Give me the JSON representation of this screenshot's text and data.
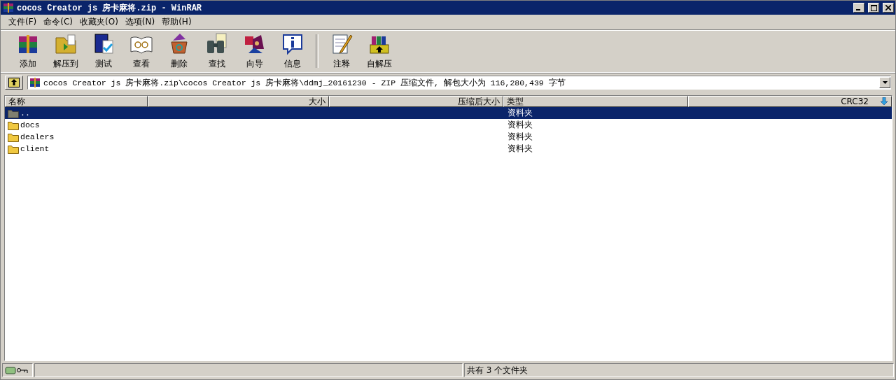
{
  "window": {
    "title": "cocos Creator js 房卡麻将.zip - WinRAR"
  },
  "menu": [
    {
      "label": "文件(F)"
    },
    {
      "label": "命令(C)"
    },
    {
      "label": "收藏夹(O)"
    },
    {
      "label": "选项(N)"
    },
    {
      "label": "帮助(H)"
    }
  ],
  "toolbar": [
    {
      "label": "添加"
    },
    {
      "label": "解压到"
    },
    {
      "label": "测试"
    },
    {
      "label": "查看"
    },
    {
      "label": "删除"
    },
    {
      "label": "查找"
    },
    {
      "label": "向导"
    },
    {
      "label": "信息"
    },
    {
      "label": "注释"
    },
    {
      "label": "自解压"
    }
  ],
  "address": {
    "value": "cocos Creator js 房卡麻将.zip\\cocos Creator js 房卡麻将\\ddmj_20161230 - ZIP 压缩文件, 解包大小为 116,280,439 字节"
  },
  "table": {
    "columns": [
      {
        "label": "名称"
      },
      {
        "label": "大小"
      },
      {
        "label": "压缩后大小"
      },
      {
        "label": "类型"
      },
      {
        "label": "CRC32"
      }
    ],
    "rows": [
      {
        "name": "..",
        "type": "资料夹",
        "selected": true
      },
      {
        "name": "docs",
        "type": "资料夹",
        "selected": false
      },
      {
        "name": "dealers",
        "type": "资料夹",
        "selected": false
      },
      {
        "name": "client",
        "type": "资料夹",
        "selected": false
      }
    ]
  },
  "status_bar": {
    "text": "共有 3 个文件夹"
  }
}
